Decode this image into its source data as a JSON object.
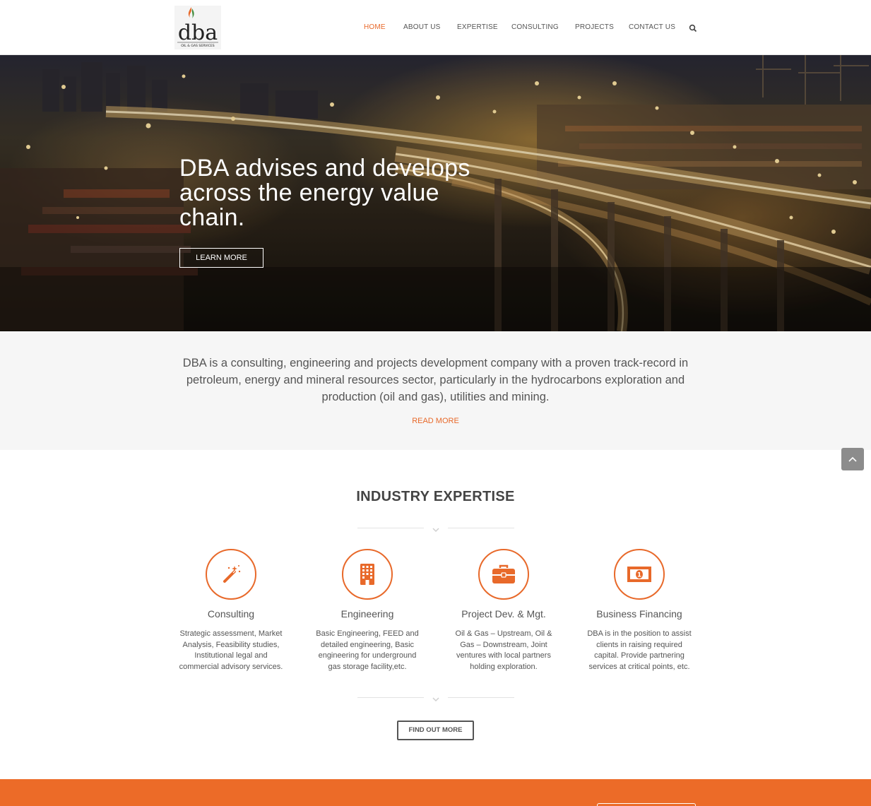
{
  "brand": {
    "logo_name": "dba",
    "logo_tagline": "OIL & GAS SERVICES",
    "accent": "#e8692a",
    "band_color": "#ec6b28"
  },
  "nav": {
    "items": [
      {
        "label": "HOME",
        "active": true
      },
      {
        "label": "ABOUT US",
        "active": false
      },
      {
        "label": "EXPERTISE",
        "active": false
      },
      {
        "label": "CONSULTING",
        "active": false
      },
      {
        "label": "PROJECTS",
        "active": false
      },
      {
        "label": "CONTACT US",
        "active": false
      }
    ],
    "search_icon": "search-icon"
  },
  "hero": {
    "title": "DBA advises and develops across the energy value chain.",
    "button_label": "LEARN MORE"
  },
  "intro": {
    "text": "DBA is a consulting, engineering and projects development company with a proven track-record in petroleum, energy and mineral resources sector, particularly in the hydrocarbons exploration and production (oil and gas), utilities and mining.",
    "link_label": "READ MORE"
  },
  "expertise": {
    "title": "INDUSTRY EXPERTISE",
    "cards": [
      {
        "icon": "magic-wand-icon",
        "title": "Consulting",
        "text": "Strategic assessment, Market Analysis, Feasibility studies, Institutional legal and commercial advisory services."
      },
      {
        "icon": "building-icon",
        "title": "Engineering",
        "text": "Basic Engineering, FEED and detailed engineering, Basic engineering for underground gas storage facility,etc."
      },
      {
        "icon": "briefcase-icon",
        "title": "Project Dev. & Mgt.",
        "text": "Oil & Gas – Upstream, Oil & Gas – Downstream, Joint ventures with local partners holding exploration."
      },
      {
        "icon": "money-icon",
        "title": "Business Financing",
        "text": "DBA is in the position to assist clients in raising required capital. Provide partnering services at critical points, etc."
      }
    ],
    "button_label": "FIND OUT MORE"
  },
  "scroll_top_icon": "chevron-up-icon"
}
